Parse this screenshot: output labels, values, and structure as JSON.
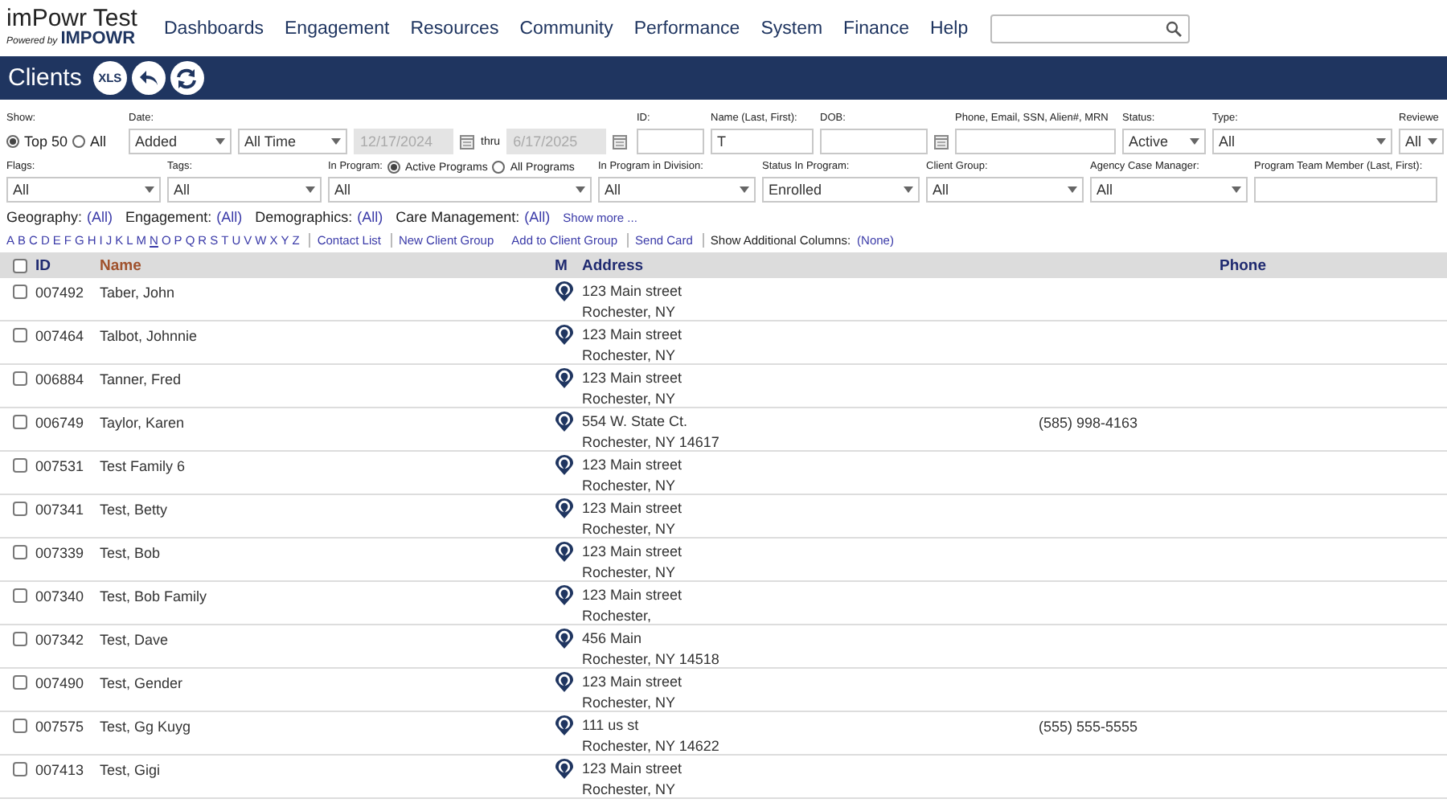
{
  "header": {
    "title": "imPowr Test",
    "powered_by": "Powered by",
    "brand": "IMPOWR",
    "nav": [
      "Dashboards",
      "Engagement",
      "Resources",
      "Community",
      "Performance",
      "System",
      "Finance",
      "Help"
    ]
  },
  "toolbar": {
    "title": "Clients",
    "buttons": [
      {
        "kind": "text",
        "label": "XLS"
      },
      {
        "kind": "back"
      },
      {
        "kind": "refresh"
      }
    ]
  },
  "filters": {
    "main_filters": [
      {
        "kind": "radio",
        "label": "Show:",
        "options": [
          {
            "label": "Top 50",
            "selected": true
          },
          {
            "label": "All",
            "selected": false
          }
        ]
      },
      {
        "kind": "date-range",
        "label": "Date:",
        "field": "Added",
        "period": "All Time",
        "from": "12/17/2024",
        "separator": "thru",
        "to": "6/17/2025",
        "disabled": true
      },
      {
        "kind": "text",
        "label": "ID:"
      },
      {
        "kind": "text",
        "label": "Name (Last, First):",
        "value": "T"
      },
      {
        "kind": "date",
        "label": "DOB:"
      },
      {
        "kind": "text",
        "label": "Phone, Email, SSN, Alien#, MRN"
      },
      {
        "kind": "select",
        "label": "Status:",
        "value": "Active"
      },
      {
        "kind": "select",
        "label": "Type:",
        "value": "All"
      },
      {
        "kind": "select",
        "label": "Reviewe",
        "value": "All"
      }
    ],
    "program_filters": [
      {
        "kind": "select",
        "label": "Flags:",
        "value": "All"
      },
      {
        "kind": "select",
        "label": "Tags:",
        "value": "All"
      },
      {
        "kind": "radio-select",
        "label": "In Program:",
        "options": [
          {
            "label": "Active Programs",
            "selected": true
          },
          {
            "label": "All Programs",
            "selected": false
          }
        ],
        "value": "All"
      },
      {
        "kind": "select",
        "label": "In Program in Division:",
        "value": "All"
      },
      {
        "kind": "select",
        "label": "Status In Program:",
        "value": "Enrolled"
      },
      {
        "kind": "select",
        "label": "Client Group:",
        "value": "All"
      },
      {
        "kind": "select",
        "label": "Agency Case Manager:",
        "value": "All"
      },
      {
        "kind": "text",
        "label": "Program Team Member (Last, First):"
      }
    ],
    "categories": [
      {
        "name": "Geography:",
        "value": "(All)"
      },
      {
        "name": "Engagement:",
        "value": "(All)"
      },
      {
        "name": "Demographics:",
        "value": "(All)"
      },
      {
        "name": "Care Management:",
        "value": "(All)"
      }
    ],
    "show_more": "Show more ..."
  },
  "alphabet": [
    {
      "letter": "A",
      "selected": false
    },
    {
      "letter": "B",
      "selected": false
    },
    {
      "letter": "C",
      "selected": false
    },
    {
      "letter": "D",
      "selected": false
    },
    {
      "letter": "E",
      "selected": false
    },
    {
      "letter": "F",
      "selected": false
    },
    {
      "letter": "G",
      "selected": false
    },
    {
      "letter": "H",
      "selected": false
    },
    {
      "letter": "I",
      "selected": false
    },
    {
      "letter": "J",
      "selected": false
    },
    {
      "letter": "K",
      "selected": false
    },
    {
      "letter": "L",
      "selected": false
    },
    {
      "letter": "M",
      "selected": false
    },
    {
      "letter": "N",
      "selected": true
    },
    {
      "letter": "O",
      "selected": false
    },
    {
      "letter": "P",
      "selected": false
    },
    {
      "letter": "Q",
      "selected": false
    },
    {
      "letter": "R",
      "selected": false
    },
    {
      "letter": "S",
      "selected": false
    },
    {
      "letter": "T",
      "selected": false
    },
    {
      "letter": "U",
      "selected": false
    },
    {
      "letter": "V",
      "selected": false
    },
    {
      "letter": "W",
      "selected": false
    },
    {
      "letter": "X",
      "selected": false
    },
    {
      "letter": "Y",
      "selected": false
    },
    {
      "letter": "Z",
      "selected": false
    }
  ],
  "actions": [
    {
      "label": "Contact List",
      "divider_before": true
    },
    {
      "label": "New Client Group",
      "divider_before": true
    },
    {
      "label": "Add to Client Group",
      "divider_before": false
    },
    {
      "label": "Send Card",
      "divider_before": true
    },
    {
      "label": "Show Additional Columns:",
      "value": "(None)",
      "divider_before": true
    }
  ],
  "table": {
    "select_all": {
      "checked": false
    },
    "columns": [
      {
        "label": "ID",
        "sorted": false
      },
      {
        "label": "Name",
        "sorted": true
      },
      {
        "label": "M",
        "sorted": false
      },
      {
        "label": "Address",
        "sorted": false
      },
      {
        "label": "Phone",
        "sorted": false
      }
    ],
    "rows": [
      {
        "checked": false,
        "id": "007492",
        "name": "Taber, John",
        "address": [
          "123 Main street",
          "Rochester, NY"
        ]
      },
      {
        "checked": false,
        "id": "007464",
        "name": "Talbot, Johnnie",
        "address": [
          "123 Main street",
          "Rochester, NY"
        ]
      },
      {
        "checked": false,
        "id": "006884",
        "name": "Tanner, Fred",
        "address": [
          "123 Main street",
          "Rochester, NY"
        ]
      },
      {
        "checked": false,
        "id": "006749",
        "name": "Taylor, Karen",
        "address": [
          "554 W. State Ct.",
          "Rochester, NY 14617"
        ],
        "phone": "(585) 998-4163"
      },
      {
        "checked": false,
        "id": "007531",
        "name": "Test Family 6",
        "address": [
          "123 Main street",
          "Rochester, NY"
        ]
      },
      {
        "checked": false,
        "id": "007341",
        "name": "Test, Betty",
        "address": [
          "123 Main street",
          "Rochester, NY"
        ]
      },
      {
        "checked": false,
        "id": "007339",
        "name": "Test, Bob",
        "address": [
          "123 Main street",
          "Rochester, NY"
        ]
      },
      {
        "checked": false,
        "id": "007340",
        "name": "Test, Bob Family",
        "address": [
          "123 Main street",
          "Rochester,"
        ]
      },
      {
        "checked": false,
        "id": "007342",
        "name": "Test, Dave",
        "address": [
          "456 Main",
          "Rochester, NY 14518"
        ]
      },
      {
        "checked": false,
        "id": "007490",
        "name": "Test, Gender",
        "address": [
          "123 Main street",
          "Rochester, NY"
        ]
      },
      {
        "checked": false,
        "id": "007575",
        "name": "Test, Gg Kuyg",
        "address": [
          "111 us st",
          "Rochester, NY 14622"
        ],
        "phone": "(555) 555-5555"
      },
      {
        "checked": false,
        "id": "007413",
        "name": "Test, Gigi",
        "address": [
          "123 Main street",
          "Rochester, NY"
        ]
      }
    ]
  }
}
